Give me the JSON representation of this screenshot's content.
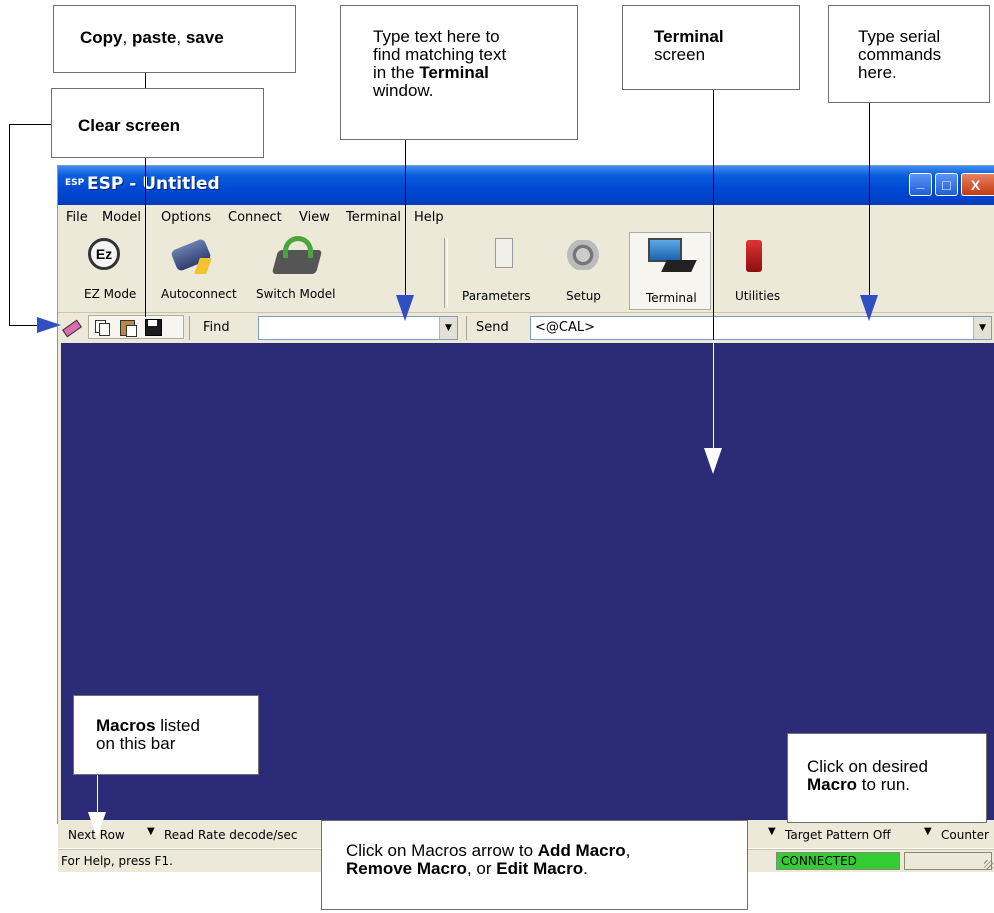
{
  "window": {
    "logo": "ESP",
    "title": "ESP - Untitled",
    "minimize_glyph": "_",
    "maximize_glyph": "□",
    "close_glyph": "X"
  },
  "menu": [
    "File",
    "Model",
    "Options",
    "Connect",
    "View",
    "Terminal",
    "Help"
  ],
  "toolbar": {
    "ez_mode": "EZ Mode",
    "autoconnect": "Autoconnect",
    "switch_model": "Switch Model",
    "parameters": "Parameters",
    "setup": "Setup",
    "terminal": "Terminal",
    "utilities": "Utilities"
  },
  "findbar": {
    "find_label": "Find",
    "find_value": "",
    "send_label": "Send",
    "send_value": "<@CAL>"
  },
  "macros": [
    "Next Row",
    "Read Rate decode/sec",
    "Target Pattern Off",
    "Counter"
  ],
  "status": {
    "help": "For Help, press F1.",
    "connection": "CONNECTED",
    "connection_color": "#33cc33"
  },
  "callouts": {
    "copy_paste_save": {
      "parts": [
        "Copy",
        ", ",
        "paste",
        ", ",
        "save"
      ]
    },
    "clear_screen": "Clear screen",
    "find_text": {
      "line1": "Type text here to",
      "line2": "find matching text",
      "line3a": "in the ",
      "line3b": "Terminal",
      "line4": "window."
    },
    "terminal_screen": {
      "bold": "Terminal",
      "rest": "screen"
    },
    "serial_commands": {
      "line1": "Type serial",
      "line2": "commands",
      "line3": "here."
    },
    "macros_bar": {
      "bold": "Macros",
      "rest1": " listed",
      "line2": "on this bar"
    },
    "click_macro": {
      "line1": "Click on desired",
      "bold": "Macro",
      "rest": " to run."
    },
    "macros_arrow": {
      "line1a": "Click on Macros arrow to ",
      "line1b": "Add Macro",
      "line1c": ",",
      "line2a": "Remove Macro",
      "line2b": ", or ",
      "line2c": "Edit Macro",
      "line2d": "."
    }
  }
}
